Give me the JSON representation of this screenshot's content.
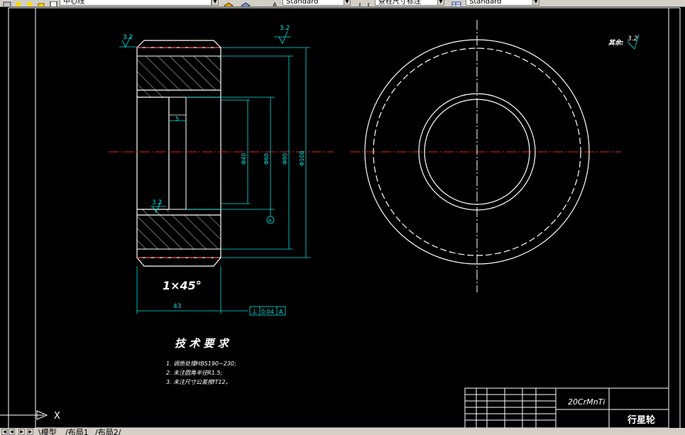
{
  "toolbar": {
    "layer_label": "中心线",
    "text_style": "Standard",
    "dim_style": "查柱尺寸标注",
    "table_style": "Standard"
  },
  "drawing": {
    "roughness_top_left": "3.2",
    "roughness_top_mid": "3.2",
    "roughness_inner": "3.2",
    "other_roughness_label": "其余:",
    "other_roughness_value": "3.2",
    "chamfer": "1×45°",
    "dim_width": "43",
    "dim_step": "5",
    "dim_d1": "Φ40",
    "dim_d2": "Φ60",
    "dim_d3": "Φ90",
    "dim_d4": "Φ108",
    "tol_symbol": "⊥",
    "tol_value": "0.04",
    "tol_datum": "A",
    "datum_label": "A",
    "tech_title": "技 术 要 求",
    "tech_req": [
      "1. 调质处理HBS190~230;",
      "2. 未注圆角半径R1.5;",
      "3. 未注尺寸公差按IT12。"
    ],
    "material": "20CrMnTi",
    "part_name": "行星轮",
    "ucs_x": "X"
  },
  "tabs": {
    "model": "模型",
    "layout1": "布局1",
    "layout2": "布局2"
  },
  "colors": {
    "background": "#000000",
    "lines": "#ffffff",
    "dimensions": "#00e5e5",
    "centerline": "#e52020"
  }
}
